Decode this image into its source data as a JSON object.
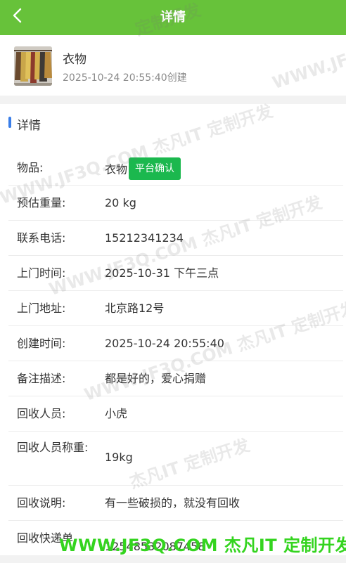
{
  "header": {
    "title": "详情"
  },
  "summary": {
    "item_name": "衣物",
    "created_at": "2025-10-24 20:55:40创建"
  },
  "section": {
    "title": "详情"
  },
  "fields": [
    {
      "label": "物品:",
      "value": "衣物",
      "tag": "平台确认"
    },
    {
      "label": "预估重量:",
      "value": "20 kg"
    },
    {
      "label": "联系电话:",
      "value": "15212341234"
    },
    {
      "label": "上门时间:",
      "value": "2025-10-31 下午三点"
    },
    {
      "label": "上门地址:",
      "value": "北京路12号"
    },
    {
      "label": "创建时间:",
      "value": "2025-10-24 20:55:40"
    },
    {
      "label": "备注描述:",
      "value": "都是好的，爱心捐赠"
    },
    {
      "label": "回收人员:",
      "value": "小虎"
    },
    {
      "label": "回收人员称重:",
      "value": "19kg"
    },
    {
      "label": "回收说明:",
      "value": "有一些破损的，就没有回收"
    },
    {
      "label": "回收快递单",
      "value": "12548532087458"
    }
  ],
  "watermark": {
    "short": "定制开发",
    "long": "WWW.JF3Q.COM 杰凡IT 定制开发",
    "mid": "杰凡IT 定制开发",
    "end": "WWW.JF3",
    "footer": "WWW.JF3Q.COM 杰凡IT  定制开发"
  },
  "colors": {
    "accent": "#67c23a",
    "tag": "#1bb84e",
    "section_bar": "#3a7ee8",
    "footer_mark": "#34d41f"
  },
  "icons": {
    "back": "chevron-left-icon"
  }
}
